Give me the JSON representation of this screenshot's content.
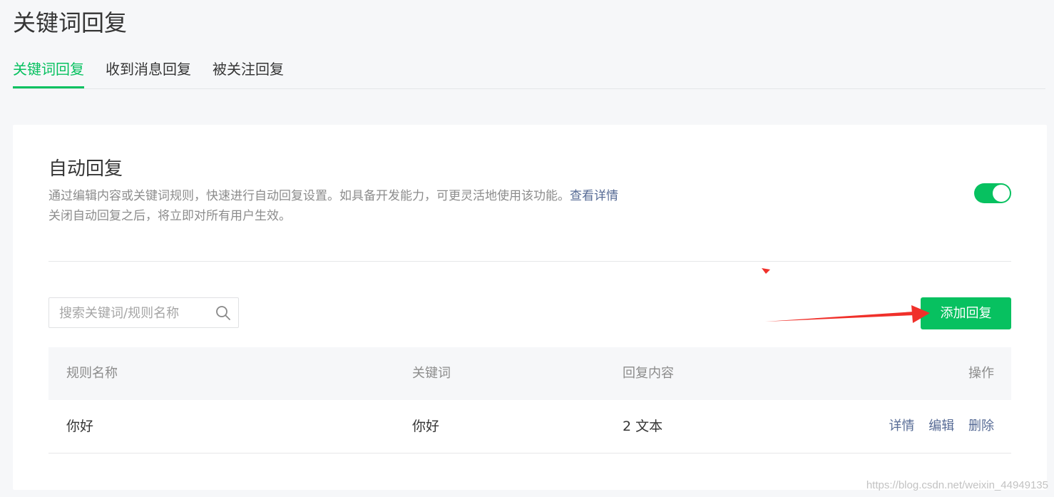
{
  "page": {
    "title": "关键词回复"
  },
  "tabs": [
    {
      "label": "关键词回复",
      "active": true
    },
    {
      "label": "收到消息回复",
      "active": false
    },
    {
      "label": "被关注回复",
      "active": false
    }
  ],
  "auto_reply": {
    "title": "自动回复",
    "desc_line1": "通过编辑内容或关键词规则，快速进行自动回复设置。如具备开发能力，可更灵活地使用该功能。",
    "details_link": "查看详情",
    "desc_line2": "关闭自动回复之后，将立即对所有用户生效。",
    "enabled": true
  },
  "search": {
    "placeholder": "搜索关键词/规则名称",
    "value": ""
  },
  "add_button": {
    "label": "添加回复"
  },
  "table": {
    "headers": {
      "rule_name": "规则名称",
      "keyword": "关键词",
      "reply_content": "回复内容",
      "actions": "操作"
    },
    "rows": [
      {
        "rule_name": "你好",
        "keyword": "你好",
        "reply_content": "2 文本",
        "actions": [
          "详情",
          "编辑",
          "删除"
        ]
      }
    ]
  },
  "watermark": "https://blog.csdn.net/weixin_44949135",
  "colors": {
    "accent": "#07c160",
    "link": "#576b95",
    "annotation_arrow": "#f0302a"
  }
}
